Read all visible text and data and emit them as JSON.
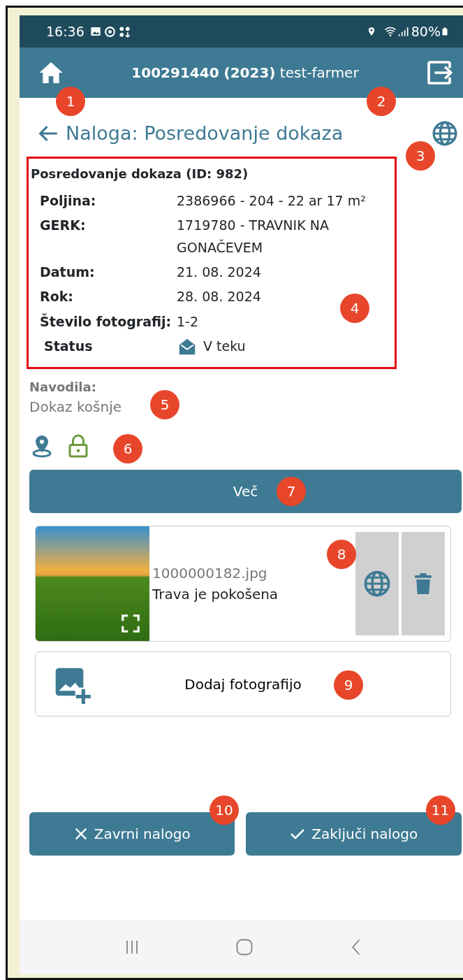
{
  "status_bar": {
    "time": "16:36",
    "battery": "80%"
  },
  "app_bar": {
    "title": "**100291440 (2023)** test-farmer"
  },
  "page": {
    "title": "Naloga: Posredovanje dokaza",
    "back_marker": "1",
    "title_marker": "2",
    "globe_marker": "3"
  },
  "details": {
    "heading": "Posredovanje dokaza (ID: 982)",
    "marker": "4",
    "rows": [
      {
        "kind": "text",
        "label": "Poljina:",
        "value": "2386966 - 204 - 22 ar 17 m²"
      },
      {
        "kind": "text",
        "label": "GERK:",
        "value": "1719780 - TRAVNIK NA GONAČEVEM"
      },
      {
        "kind": "text",
        "label": "Datum:",
        "value": "21. 08. 2024"
      },
      {
        "kind": "text",
        "label": "Rok:",
        "value": "28. 08. 2024"
      },
      {
        "kind": "text",
        "label": "Število fotografij:",
        "value": "1-2"
      },
      {
        "kind": "status",
        "label": "Status",
        "value": "V teku"
      }
    ]
  },
  "instructions": {
    "label": "Navodila:",
    "text": "Dokaz košnje",
    "marker": "5"
  },
  "icons_marker": "6",
  "more_button": {
    "label": "Več",
    "marker": "7"
  },
  "photos": [
    {
      "filename": "1000000182.jpg",
      "caption": "Trava je pokošena",
      "marker": "8"
    }
  ],
  "add_photo": {
    "label": "Dodaj fotografijo",
    "marker": "9"
  },
  "actions": [
    {
      "kind": "cancel",
      "label": "Zavrni nalogo",
      "marker": "10"
    },
    {
      "kind": "confirm",
      "label": "Zaključi nalogo",
      "marker": "11"
    }
  ]
}
